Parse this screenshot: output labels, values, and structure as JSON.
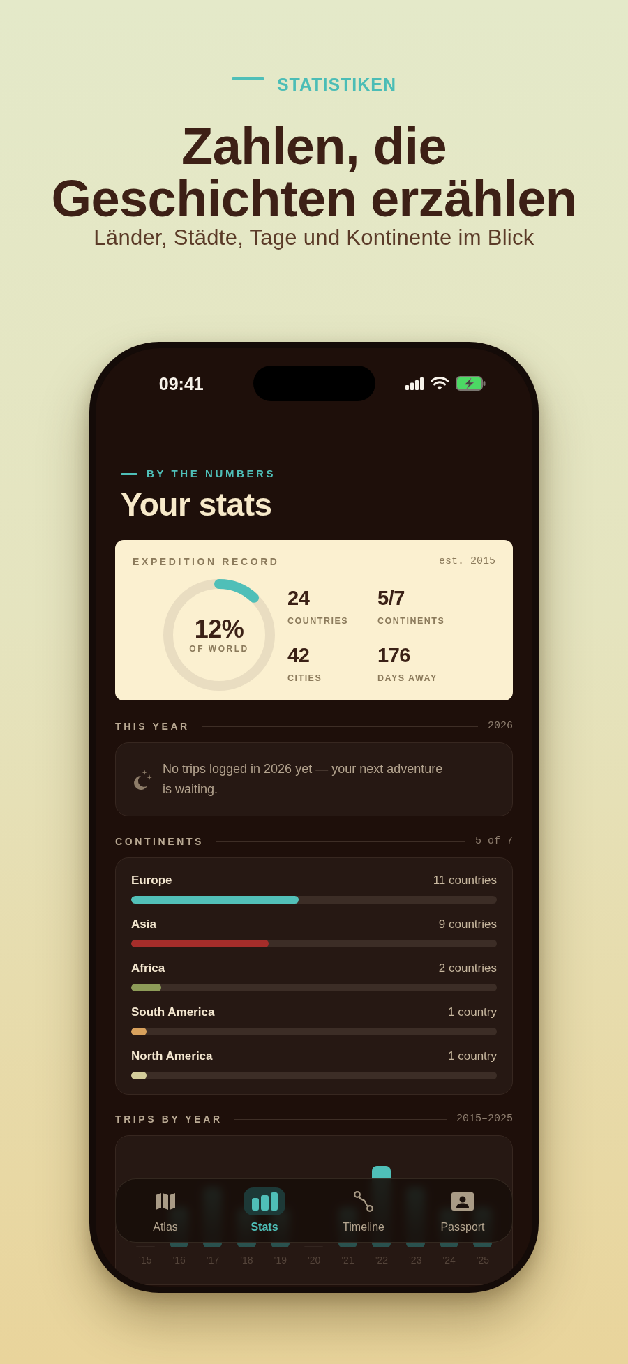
{
  "header": {
    "eyebrow": "STATISTIKEN",
    "title": "Zahlen, die Geschichten erzählen",
    "subtitle": "Länder, Städte, Tage und Kontinente im Blick"
  },
  "status_bar": {
    "time": "09:41"
  },
  "screen_header": {
    "eyebrow": "BY THE NUMBERS",
    "title": "Your stats"
  },
  "expedition_record": {
    "title": "EXPEDITION RECORD",
    "since": "est. 2015",
    "world": {
      "value": "12%",
      "label": "OF WORLD",
      "level": 0.12
    },
    "stats": [
      {
        "value": "24",
        "label": "COUNTRIES"
      },
      {
        "value": "5/7",
        "label": "CONTINENTS"
      },
      {
        "value": "42",
        "label": "CITIES"
      },
      {
        "value": "176",
        "label": "DAYS AWAY"
      }
    ]
  },
  "this_year": {
    "title": "THIS YEAR",
    "meta": "2026",
    "message": "No trips logged in 2026 yet — your next adventure is waiting."
  },
  "continents": {
    "title": "CONTINENTS",
    "meta": "5 of 7",
    "items": [
      {
        "name": "Europe",
        "count": "11 countries",
        "level": 0.458,
        "color": "#52c0b8"
      },
      {
        "name": "Asia",
        "count": "9 countries",
        "level": 0.375,
        "color": "#a52d2a"
      },
      {
        "name": "Africa",
        "count": "2 countries",
        "level": 0.083,
        "color": "#8d9b58"
      },
      {
        "name": "South America",
        "count": "1 country",
        "level": 0.042,
        "color": "#d8a15d"
      },
      {
        "name": "North America",
        "count": "1 country",
        "level": 0.042,
        "color": "#d3cc9a"
      }
    ]
  },
  "trips_by_year": {
    "title": "TRIPS BY YEAR",
    "meta": "2015–2025",
    "year_labels": [
      "’15",
      "’16",
      "’17",
      "’18",
      "’19",
      "’20",
      "’21",
      "’22",
      "’23",
      "’24",
      "’25"
    ]
  },
  "tab_bar": {
    "tabs": [
      {
        "label": "Atlas",
        "selected": false
      },
      {
        "label": "Stats",
        "selected": true
      },
      {
        "label": "Timeline",
        "selected": false
      },
      {
        "label": "Passport",
        "selected": false
      }
    ]
  }
}
